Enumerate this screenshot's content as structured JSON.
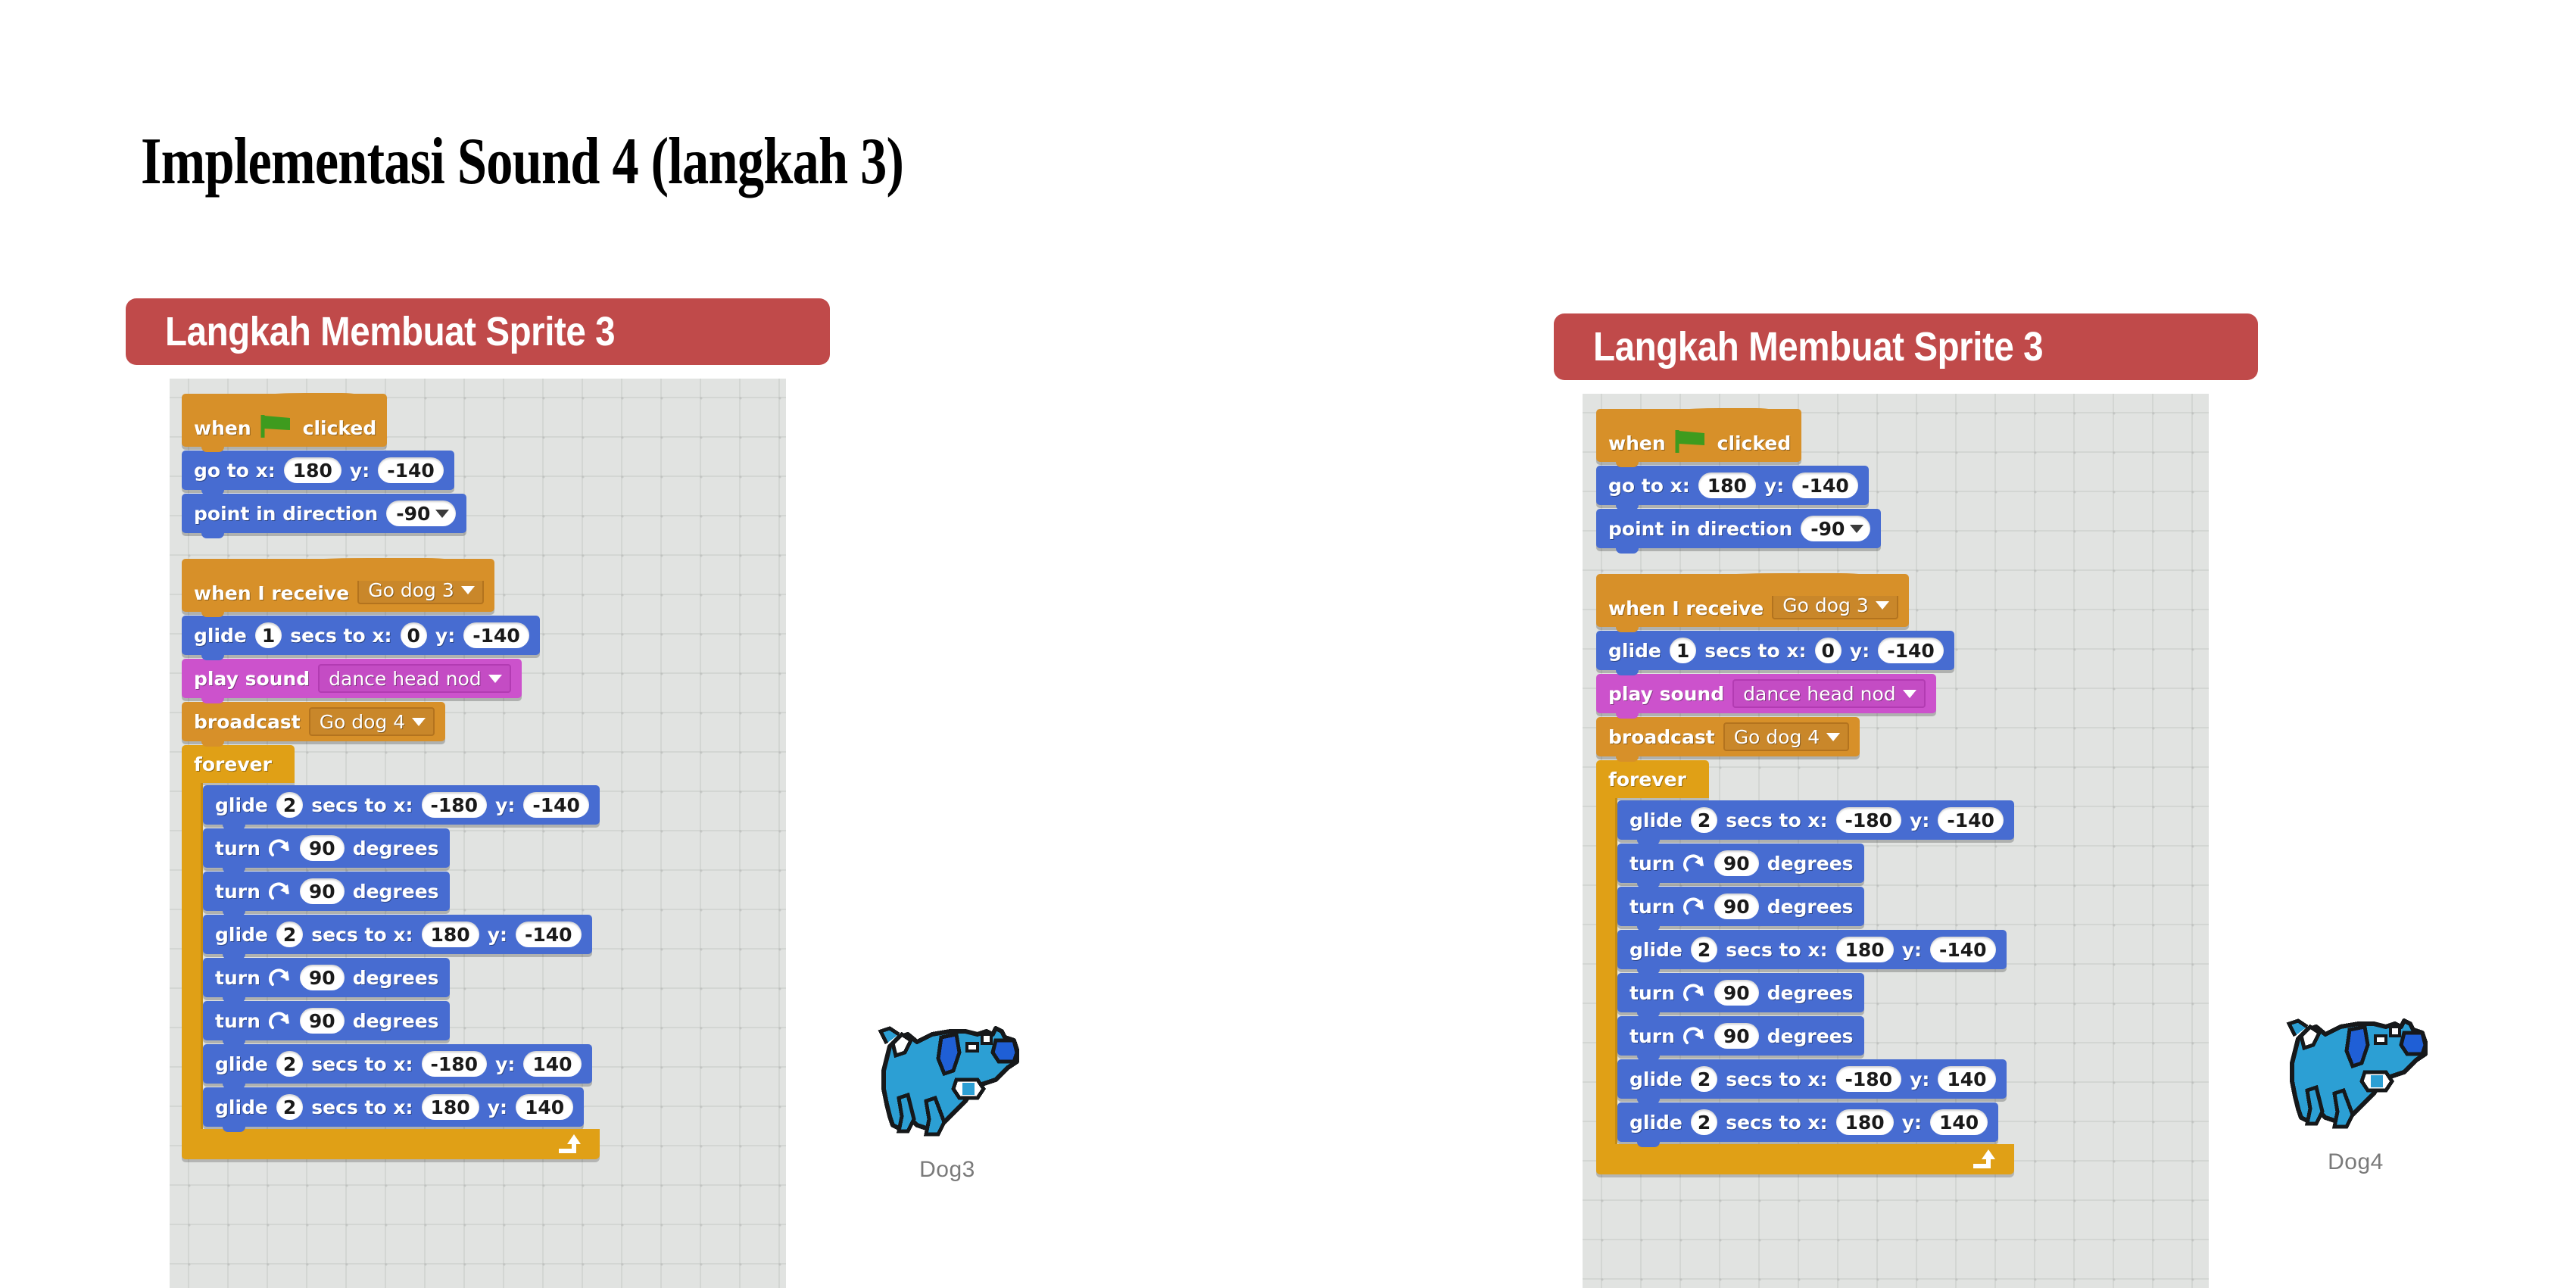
{
  "slide": {
    "title": "Implementasi Sound 4 (langkah 3)",
    "accent_color": "#C04A4A",
    "canvas_color": "#E1E3E1"
  },
  "panels": [
    {
      "id": "left",
      "header": "Langkah Membuat Sprite 3",
      "sprite_label": "Dog3",
      "sprite_icon": "blue-dog-sprite"
    },
    {
      "id": "right",
      "header": "Langkah Membuat Sprite 3",
      "sprite_label": "Dog4",
      "sprite_icon": "blue-dog-sprite"
    }
  ],
  "script": {
    "hat_flag": {
      "when": "when",
      "clicked": "clicked",
      "icon": "green-flag-icon"
    },
    "go_to": {
      "label": "go to x:",
      "x": "180",
      "y_label": "y:",
      "y": "-140"
    },
    "point": {
      "label": "point in direction",
      "value": "-90"
    },
    "hat_receive": {
      "label": "when I receive",
      "message": "Go dog 3"
    },
    "glide_intro": {
      "label": "glide",
      "secs": "1",
      "secs_label": "secs to x:",
      "x": "0",
      "y_label": "y:",
      "y": "-140"
    },
    "play_sound": {
      "label": "play sound",
      "sound": "dance head nod"
    },
    "broadcast": {
      "label": "broadcast",
      "message": "Go dog 4"
    },
    "forever": {
      "label": "forever",
      "icon": "loop-arrow-icon"
    },
    "loop_steps": [
      {
        "kind": "glide",
        "label": "glide",
        "secs": "2",
        "secs_label": "secs to x:",
        "x": "-180",
        "y_label": "y:",
        "y": "-140"
      },
      {
        "kind": "turn",
        "label": "turn",
        "icon": "turn-right-icon",
        "degrees": "90",
        "degrees_label": "degrees"
      },
      {
        "kind": "turn",
        "label": "turn",
        "icon": "turn-right-icon",
        "degrees": "90",
        "degrees_label": "degrees"
      },
      {
        "kind": "glide",
        "label": "glide",
        "secs": "2",
        "secs_label": "secs to x:",
        "x": "180",
        "y_label": "y:",
        "y": "-140"
      },
      {
        "kind": "turn",
        "label": "turn",
        "icon": "turn-right-icon",
        "degrees": "90",
        "degrees_label": "degrees"
      },
      {
        "kind": "turn",
        "label": "turn",
        "icon": "turn-right-icon",
        "degrees": "90",
        "degrees_label": "degrees"
      },
      {
        "kind": "glide",
        "label": "glide",
        "secs": "2",
        "secs_label": "secs to x:",
        "x": "-180",
        "y_label": "y:",
        "y": "140"
      },
      {
        "kind": "glide",
        "label": "glide",
        "secs": "2",
        "secs_label": "secs to x:",
        "x": "180",
        "y_label": "y:",
        "y": "140"
      }
    ]
  },
  "colors": {
    "motion": "#476CD1",
    "events": "#D79029",
    "sound": "#CC52CC",
    "control": "#E0A016",
    "flag_green": "#3E9B1E",
    "dog_blue": "#2C9FD4",
    "dog_ear": "#1F5FD6"
  }
}
